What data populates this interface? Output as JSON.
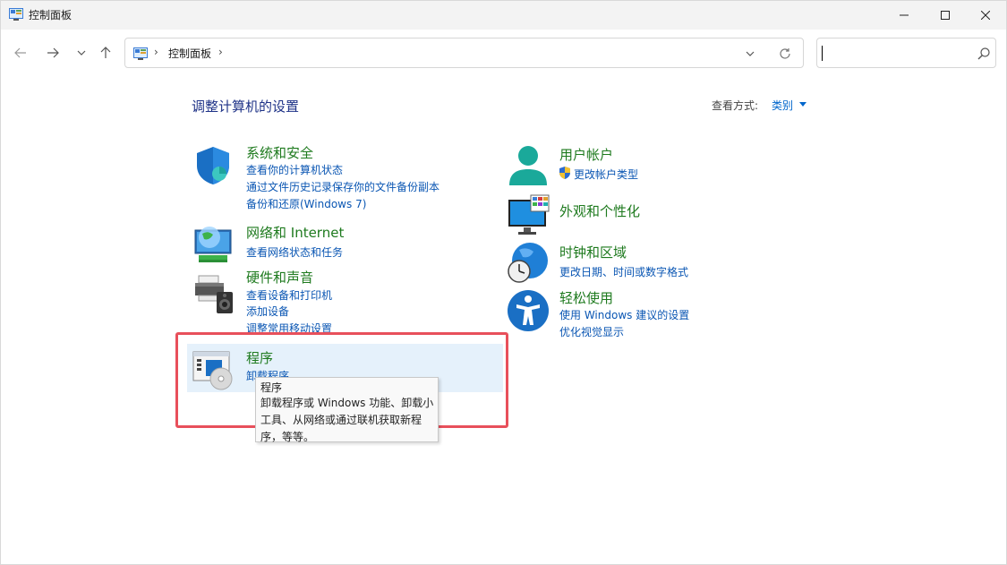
{
  "window": {
    "title": "控制面板",
    "controls": {
      "minimize": "minimize",
      "maximize": "maximize",
      "close": "close"
    }
  },
  "address": {
    "crumbs": [
      "控制面板"
    ],
    "search_placeholder": ""
  },
  "content": {
    "heading": "调整计算机的设置",
    "view_by_label": "查看方式:",
    "view_by_value": "类别"
  },
  "categories": [
    {
      "title": "系统和安全",
      "icon": "shield-icon",
      "links": [
        "查看你的计算机状态",
        "通过文件历史记录保存你的文件备份副本",
        "备份和还原(Windows 7)"
      ]
    },
    {
      "title": "网络和 Internet",
      "icon": "network-globe-icon",
      "links": [
        "查看网络状态和任务"
      ]
    },
    {
      "title": "硬件和声音",
      "icon": "printer-speaker-icon",
      "links": [
        "查看设备和打印机",
        "添加设备",
        "调整常用移动设置"
      ]
    },
    {
      "title": "程序",
      "icon": "programs-disc-icon",
      "links": [
        "卸载程序"
      ]
    },
    {
      "title": "用户帐户",
      "icon": "user-account-icon",
      "links": [
        "更改帐户类型"
      ]
    },
    {
      "title": "外观和个性化",
      "icon": "monitor-palette-icon",
      "links": []
    },
    {
      "title": "时钟和区域",
      "icon": "clock-globe-icon",
      "links": [
        "更改日期、时间或数字格式"
      ]
    },
    {
      "title": "轻松使用",
      "icon": "accessibility-icon",
      "links": [
        "使用 Windows 建议的设置",
        "优化视觉显示"
      ]
    }
  ],
  "tooltip": {
    "title": "程序",
    "body": "卸载程序或 Windows 功能、卸载小工具、从网络或通过联机获取新程序，等等。"
  },
  "colors": {
    "category_title": "#1e7a1e",
    "link": "#0a56b3",
    "heading": "#1e3287",
    "highlight": "#e8505b",
    "hover": "#e5f1fb"
  }
}
